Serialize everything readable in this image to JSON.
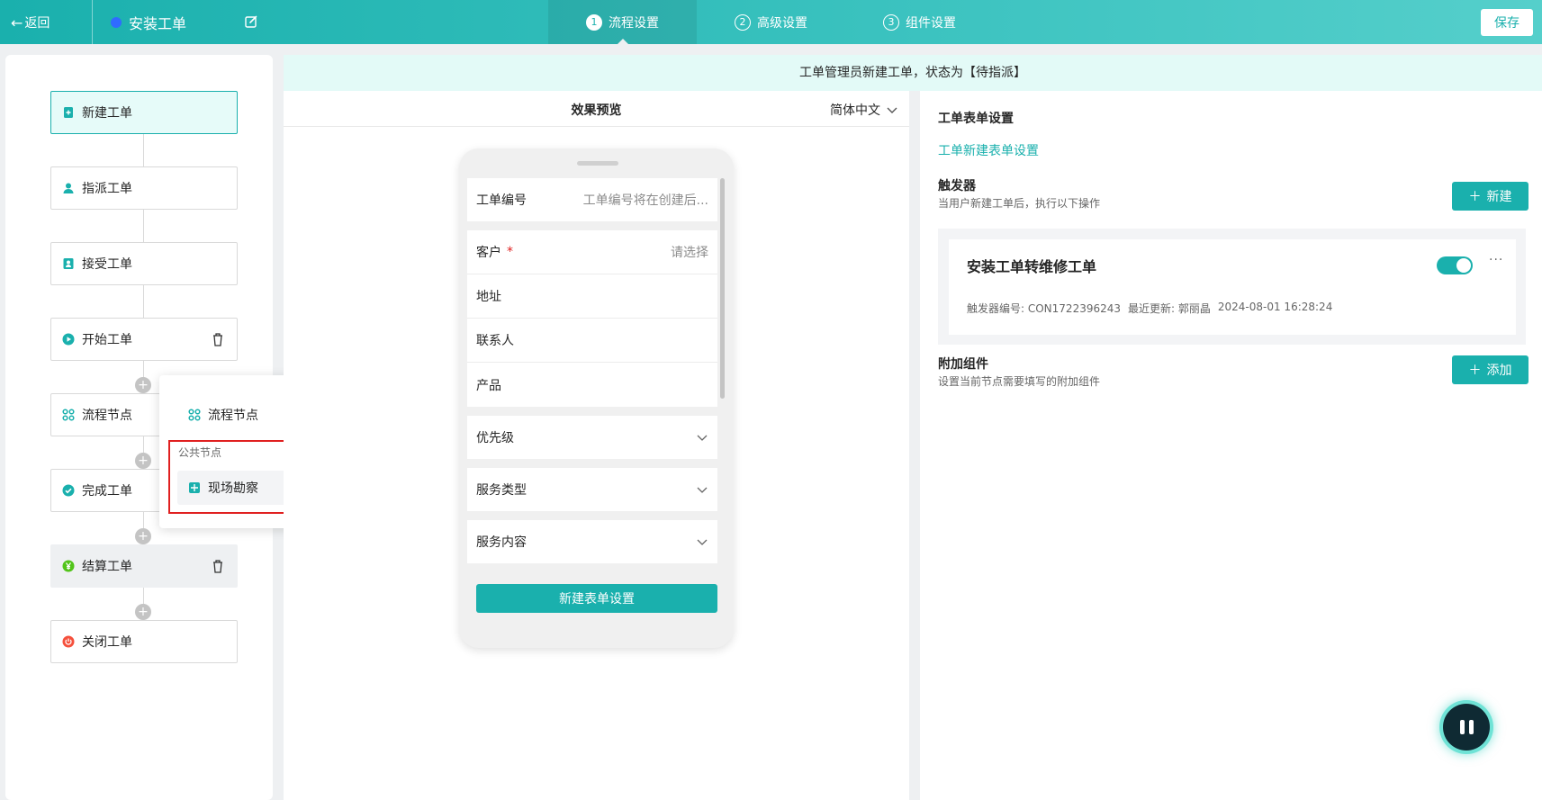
{
  "header": {
    "back_label": "返回",
    "title": "安装工单",
    "tabs": [
      {
        "num": "1",
        "label": "流程设置"
      },
      {
        "num": "2",
        "label": "高级设置"
      },
      {
        "num": "3",
        "label": "组件设置"
      }
    ],
    "save_label": "保存"
  },
  "flow": {
    "nodes": [
      {
        "label": "新建工单",
        "icon": "doc-plus-icon"
      },
      {
        "label": "指派工单",
        "icon": "user-icon"
      },
      {
        "label": "接受工单",
        "icon": "accept-icon"
      },
      {
        "label": "开始工单",
        "icon": "play-icon"
      },
      {
        "label": "流程节点",
        "icon": "nodes-icon"
      },
      {
        "label": "完成工单",
        "icon": "check-icon"
      },
      {
        "label": "结算工单",
        "icon": "yen-icon"
      },
      {
        "label": "关闭工单",
        "icon": "power-icon"
      }
    ],
    "popup": {
      "flow_node_label": "流程节点",
      "section_label": "公共节点",
      "survey_label": "现场勘察"
    }
  },
  "banner": "工单管理员新建工单，状态为【待指派】",
  "preview": {
    "title": "效果预览",
    "language": "简体中文",
    "fields": {
      "order_no_label": "工单编号",
      "order_no_placeholder": "工单编号将在创建后...",
      "customer_label": "客户",
      "customer_required": "*",
      "customer_placeholder": "请选择",
      "address_label": "地址",
      "contact_label": "联系人",
      "product_label": "产品",
      "priority_label": "优先级",
      "service_type_label": "服务类型",
      "service_content_label": "服务内容"
    },
    "button_label": "新建表单设置"
  },
  "settings": {
    "title": "工单表单设置",
    "form_link": "工单新建表单设置",
    "trigger_title": "触发器",
    "trigger_desc": "当用户新建工单后，执行以下操作",
    "new_button": "新建",
    "trigger": {
      "name": "安装工单转维修工单",
      "enabled": true,
      "code": "触发器编号: CON1722396243",
      "updated_by": "最近更新: 郭丽晶",
      "updated_at": "2024-08-01 16:28:24"
    },
    "addon_title": "附加组件",
    "addon_desc": "设置当前节点需要填写的附加组件",
    "add_button": "添加"
  },
  "colors": {
    "primary": "#1ab0ad",
    "banner_bg": "#e3faf7",
    "highlight": "#e02020"
  }
}
